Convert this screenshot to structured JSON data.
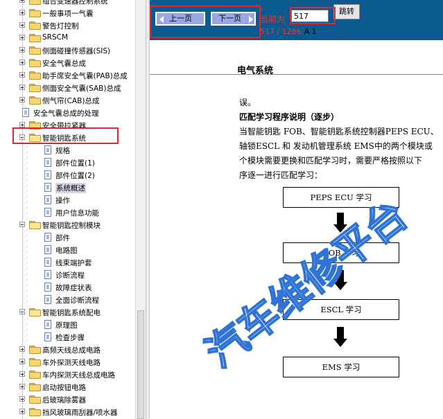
{
  "tree": {
    "items": [
      {
        "label": "组合变速器控制系统",
        "type": "folder",
        "level": 1,
        "state": "collapsed"
      },
      {
        "label": "一般事项一气囊",
        "type": "folder",
        "level": 1,
        "state": "collapsed"
      },
      {
        "label": "警告灯控制",
        "type": "folder",
        "level": 1,
        "state": "collapsed"
      },
      {
        "label": "SRSCM",
        "type": "folder",
        "level": 1,
        "state": "collapsed"
      },
      {
        "label": "侧面碰撞传感器(SIS)",
        "type": "folder",
        "level": 1,
        "state": "collapsed"
      },
      {
        "label": "安全气囊总成",
        "type": "folder",
        "level": 1,
        "state": "collapsed"
      },
      {
        "label": "助手席安全气囊(PAB)总成",
        "type": "folder",
        "level": 1,
        "state": "collapsed"
      },
      {
        "label": "侧面安全气囊(SAB)总成",
        "type": "folder",
        "level": 1,
        "state": "collapsed"
      },
      {
        "label": "侧气帘(CAB)总成",
        "type": "folder",
        "level": 1,
        "state": "collapsed"
      },
      {
        "label": "安全气囊总成的处理",
        "type": "doc",
        "level": 1
      },
      {
        "label": "安全带拉紧器",
        "type": "folder",
        "level": 1,
        "state": "collapsed"
      },
      {
        "label": "智能钥匙系统",
        "type": "folder",
        "level": 1,
        "state": "expanded"
      },
      {
        "label": "规格",
        "type": "doc",
        "level": 2
      },
      {
        "label": "部件位置(1)",
        "type": "doc",
        "level": 2
      },
      {
        "label": "部件位置(2)",
        "type": "doc",
        "level": 2
      },
      {
        "label": "系统概述",
        "type": "doc",
        "level": 2,
        "selected": true
      },
      {
        "label": "操作",
        "type": "doc",
        "level": 2
      },
      {
        "label": "用户信息功能",
        "type": "doc",
        "level": 2
      },
      {
        "label": "智能钥匙控制模块",
        "type": "folder",
        "level": 1,
        "state": "expanded"
      },
      {
        "label": "部件",
        "type": "doc",
        "level": 2
      },
      {
        "label": "电路图",
        "type": "doc",
        "level": 2
      },
      {
        "label": "线束端护套",
        "type": "doc",
        "level": 2
      },
      {
        "label": "诊断流程",
        "type": "doc",
        "level": 2
      },
      {
        "label": "故障症状表",
        "type": "doc",
        "level": 2
      },
      {
        "label": "全面诊断流程",
        "type": "doc",
        "level": 2
      },
      {
        "label": "智能钥匙系统配电",
        "type": "folder",
        "level": 1,
        "state": "expanded"
      },
      {
        "label": "原理图",
        "type": "doc",
        "level": 2
      },
      {
        "label": "检查步骤",
        "type": "doc",
        "level": 2
      },
      {
        "label": "高频天线总成电路",
        "type": "folder",
        "level": 1,
        "state": "collapsed"
      },
      {
        "label": "车外探测天线电路",
        "type": "folder",
        "level": 1,
        "state": "collapsed"
      },
      {
        "label": "车内探测天线总成电路",
        "type": "folder",
        "level": 1,
        "state": "collapsed"
      },
      {
        "label": "启动按钮电路",
        "type": "folder",
        "level": 1,
        "state": "collapsed"
      },
      {
        "label": "后玻璃除雾器",
        "type": "folder",
        "level": 1,
        "state": "collapsed"
      },
      {
        "label": "挡风玻璃雨刮器/喷水器",
        "type": "folder",
        "level": 1,
        "state": "collapsed"
      }
    ]
  },
  "toolbar": {
    "prev_label": "上一页",
    "next_label": "下一页",
    "current_label": "当前为",
    "page_input_value": "517",
    "jump_label": "跳转",
    "page_current": "517",
    "page_sep": " / ",
    "page_total": "1286",
    "suffix": "A 1"
  },
  "document": {
    "section_title": "电气系统",
    "lines": [
      "误。",
      "匹配学习程序说明（逐步）",
      "当智能钥匙 FOB、智能钥匙系统控制器PEPS ECU、",
      "轴锁ESCL 和 发动机管理系统 EMS中的两个模块或",
      "个模块需要更换和匹配学习时，需要严格按照以下",
      "序逐一进行匹配学习："
    ],
    "flow_steps": [
      "PEPS ECU 学习",
      "FOB 学习",
      "ESCL 学习",
      "EMS 学习"
    ]
  },
  "watermark": "汽车维修平台",
  "colors": {
    "toolbar_bg": "#0a5a8f",
    "highlight": "#e3262b",
    "page_text": "#e23b3b",
    "watermark_outline": "#2f73d6"
  }
}
